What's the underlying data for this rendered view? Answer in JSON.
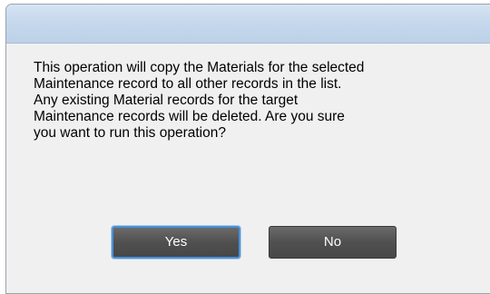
{
  "dialog": {
    "title": "",
    "message": "This operation will copy the Materials for the selected\nMaintenance record to all other records in the list.\nAny existing Material records for the target\nMaintenance records will be deleted.  Are you sure\nyou want to run this operation?",
    "buttons": {
      "yes_label": "Yes",
      "no_label": "No"
    },
    "colors": {
      "titlebar": "#c6d8ec",
      "button": "#505050",
      "focus_ring": "#4a90d9",
      "background": "#f0f0f0"
    }
  }
}
